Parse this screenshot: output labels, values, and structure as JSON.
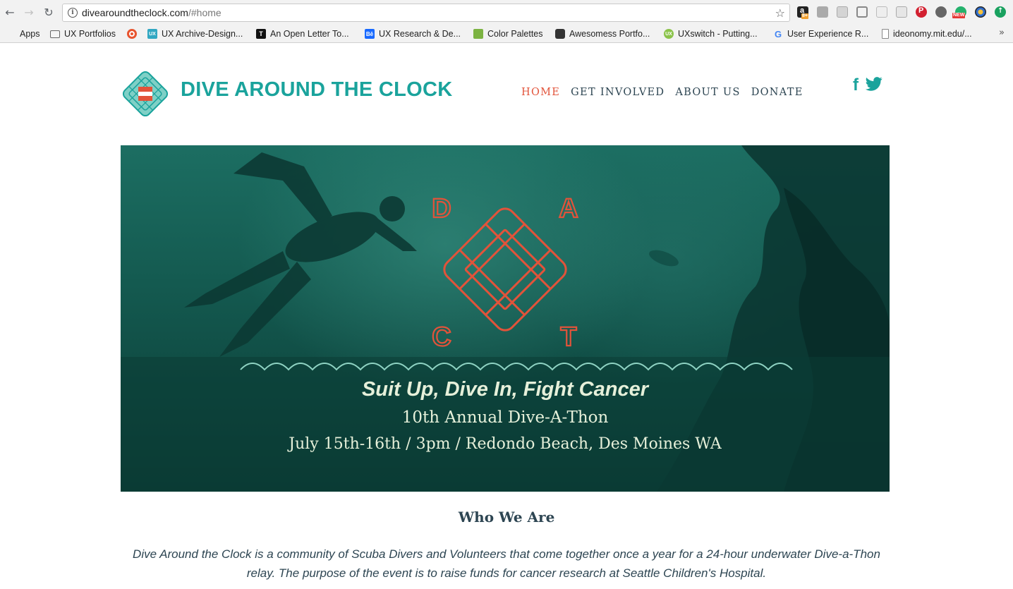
{
  "browser": {
    "url_host": "divearoundtheclock.com",
    "url_path": "/#home",
    "extensions": [
      "amazon-assistant-icon",
      "pocket-icon",
      "evernote-icon",
      "cast-icon",
      "layout-icon",
      "screenshot-icon",
      "pinterest-icon",
      "settings-icon",
      "grammarly-icon",
      "color-picker-icon",
      "upload-icon"
    ],
    "ext_badges": {
      "amazon": "8+",
      "grammarly": "NEW"
    },
    "bookmarks": [
      {
        "label": "Apps",
        "icon": "apps-grid-icon"
      },
      {
        "label": "UX Portfolios",
        "icon": "folder-icon"
      },
      {
        "label": "",
        "icon": "target-icon"
      },
      {
        "label": "UX Archive-Design...",
        "icon": "ux-archive-icon"
      },
      {
        "label": "An Open Letter To...",
        "icon": "t-icon"
      },
      {
        "label": "UX Research & De...",
        "icon": "behance-icon"
      },
      {
        "label": "Color Palettes",
        "icon": "palette-icon"
      },
      {
        "label": "Awesomess Portfo...",
        "icon": "hexagon-icon"
      },
      {
        "label": "UXswitch - Putting...",
        "icon": "ux-circle-icon"
      },
      {
        "label": "User Experience R...",
        "icon": "google-icon"
      },
      {
        "label": "ideonomy.mit.edu/...",
        "icon": "page-icon"
      }
    ],
    "more": "»"
  },
  "site": {
    "title": "DIVE AROUND THE CLOCK",
    "nav": [
      "HOME",
      "GET INVOLVED",
      "ABOUT US",
      "DONATE"
    ],
    "active_nav": "HOME",
    "social": [
      "facebook-icon",
      "twitter-icon"
    ],
    "accent": "#1aa39c",
    "highlight": "#e2533a",
    "text_color": "#2d4552"
  },
  "hero": {
    "letters": [
      "D",
      "A",
      "C",
      "T"
    ],
    "tagline": "Suit Up, Dive In, Fight Cancer",
    "subtitle": "10th Annual Dive-A-Thon",
    "date_line": "July 15th-16th / 3pm / Redondo Beach, Des Moines WA",
    "logo_color": "#e2533a",
    "wave_color": "#8fd3c3"
  },
  "about": {
    "title": "Who We Are",
    "body": "Dive Around the Clock is a community of Scuba Divers and Volunteers that come together once a year for a 24-hour underwater Dive-a-Thon relay. The purpose of the event is to raise funds for cancer research at Seattle Children's Hospital."
  }
}
